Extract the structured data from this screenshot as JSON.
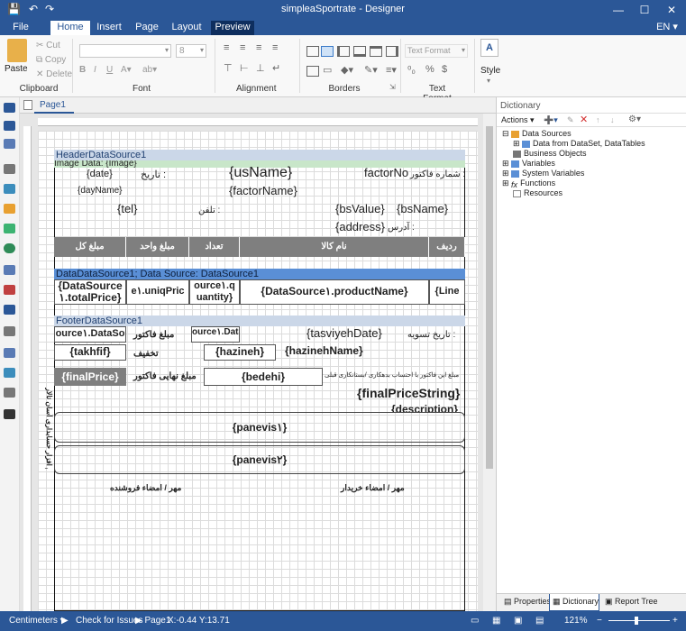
{
  "window": {
    "title": "simpleaSportrate - Designer",
    "lang": "EN"
  },
  "tabs": [
    "File",
    "Home",
    "Insert",
    "Page",
    "Layout",
    "Preview"
  ],
  "ribbon": {
    "paste": "Paste",
    "cut": "Cut",
    "copy": "Copy",
    "delete": "Delete",
    "font_size": "8",
    "text_format": "Text Format",
    "style": "Style",
    "groups": {
      "clipboard": "Clipboard",
      "font": "Font",
      "alignment": "Alignment",
      "borders": "Borders",
      "text_format": "Text Format"
    }
  },
  "page_tab": "Page1",
  "report": {
    "header_band": "HeaderDataSource1",
    "image_label": "Image Data: {Image}",
    "date": "{date}",
    "date_label": "تاریخ :",
    "day_name": "{dayName}",
    "us_name": "{usName}",
    "factor_name": "{factorName}",
    "factor_no": "factorNo",
    "factor_no_label": "شماره فاکتور :",
    "tel": "{tel}",
    "tel_label": "تلفن :",
    "bs_value": "{bsValue}",
    "bs_name": "{bsName}",
    "address": "{address}",
    "address_label": "آدرس :",
    "columns": [
      "مبلغ کل",
      "مبلغ واحد",
      "تعداد",
      "نام کالا",
      "ردیف"
    ],
    "data_band": "DataDataSource1; Data Source: DataSource1",
    "data_cells": {
      "total": "{DataSource",
      "total2": "١.totalPrice}",
      "uniq": "e١.uniqPric",
      "q": "ource١.q",
      "q2": "uantity}",
      "product": "{DataSource١.productName}",
      "line": "{Line"
    },
    "footer_band": "FooterDataSource1",
    "footer": {
      "ds": "ource١.DataSo",
      "factor_amount": "مبلغ فاکتور",
      "ds2": "ource١.Data",
      "tasviyeh": "{tasviyehDate}",
      "tasviyeh_label": "تاریخ تسویه :",
      "takhfif": "{takhfif}",
      "discount": "تخفیف",
      "hazineh": "{hazineh}",
      "hazineh_name": "{hazinehName}",
      "final_price": "{finalPrice}",
      "final_label": "مبلغ نهایی فاکتور",
      "bedehi": "{bedehi}",
      "bedehi_label": "مبلغ این فاکتور با احتساب بدهکاری /بستانکاری قبلی",
      "final_string": "{finalPriceString}",
      "description": "{description}",
      "panevis1": "{panevis١}",
      "panevis2": "{panevis٢}",
      "seller_sign": "مهر / امضاء فروشنده",
      "buyer_sign": "مهر / امضاء خریدار",
      "vertical": "نرم افزار حسابداری آسان تالار"
    }
  },
  "dictionary": {
    "title": "Dictionary",
    "actions": "Actions",
    "tree": [
      "Data Sources",
      "Data from DataSet, DataTables",
      "Business Objects",
      "Variables",
      "System Variables",
      "Functions",
      "Resources"
    ],
    "bottom_tabs": [
      "Properties",
      "Dictionary",
      "Report Tree"
    ]
  },
  "status": {
    "units": "Centimeters",
    "check": "Check for Issues",
    "page": "Page1",
    "coords": "X:-0.44 Y:13.71",
    "zoom": "121%"
  }
}
